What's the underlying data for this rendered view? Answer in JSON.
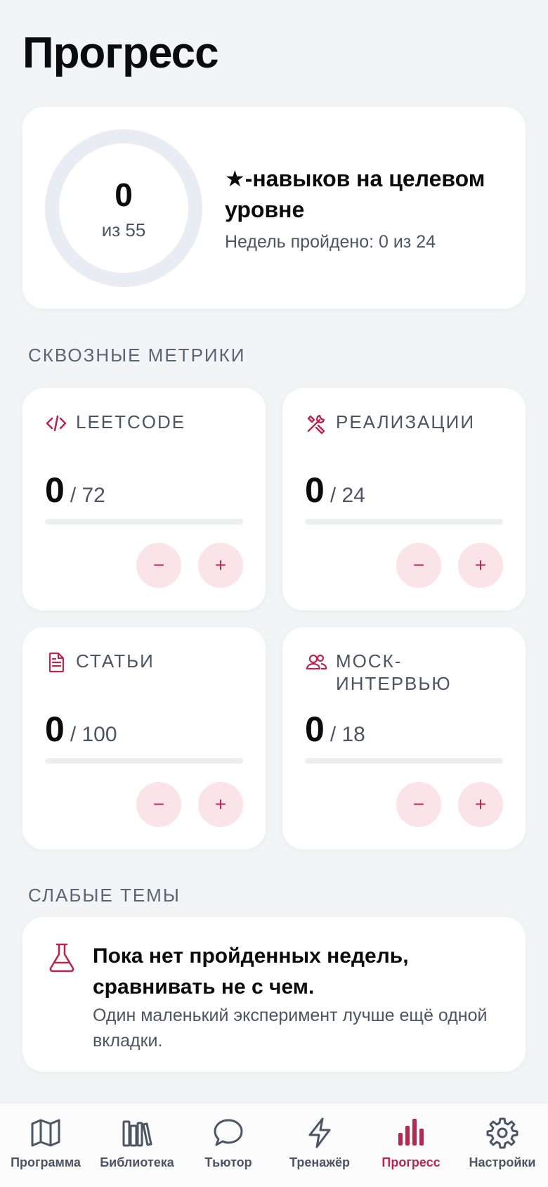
{
  "page": {
    "title": "Прогресс"
  },
  "summary": {
    "ring_value": "0",
    "ring_sub": "из 55",
    "progress_fraction": 0,
    "title": "★-навыков на целевом уровне",
    "weeks_text": "Недель пройдено: 0 из 24"
  },
  "sections": {
    "metrics_label": "СКВОЗНЫЕ МЕТРИКИ",
    "weak_label": "СЛАБЫЕ ТЕМЫ"
  },
  "metrics": [
    {
      "label": "LEETCODE",
      "icon": "code-icon",
      "value": "0",
      "total": "/ 72",
      "fraction": 0
    },
    {
      "label": "РЕАЛИЗАЦИИ",
      "icon": "tools-icon",
      "value": "0",
      "total": "/ 24",
      "fraction": 0
    },
    {
      "label": "СТАТЬИ",
      "icon": "document-icon",
      "value": "0",
      "total": "/ 100",
      "fraction": 0
    },
    {
      "label": "МОСК-ИНТЕРВЬЮ",
      "icon": "users-icon",
      "value": "0",
      "total": "/ 18",
      "fraction": 0
    }
  ],
  "buttons": {
    "minus": "−",
    "plus": "+"
  },
  "weak": {
    "icon": "flask-icon",
    "title": "Пока нет пройденных недель, сравнивать не с чем.",
    "text": "Один маленький эксперимент лучше ещё одной вкладки."
  },
  "nav": {
    "active_index": 4,
    "items": [
      {
        "label": "Программа",
        "icon": "map-icon"
      },
      {
        "label": "Библиотека",
        "icon": "library-icon"
      },
      {
        "label": "Тьютор",
        "icon": "chat-icon"
      },
      {
        "label": "Тренажёр",
        "icon": "lightning-icon"
      },
      {
        "label": "Прогресс",
        "icon": "bar-chart-icon"
      },
      {
        "label": "Настройки",
        "icon": "gear-icon"
      }
    ]
  },
  "colors": {
    "accent": "#b7284f",
    "accent_soft": "#fbe3ea",
    "ring_track": "#e9edf3"
  }
}
